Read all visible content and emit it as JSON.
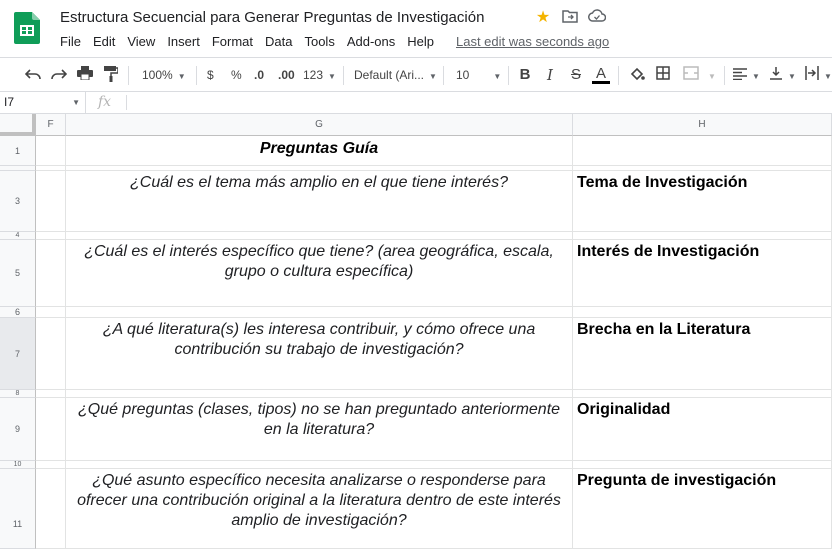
{
  "doc": {
    "title": "Estructura Secuencial para Generar Preguntas de Investigación",
    "last_edit": "Last edit was seconds ago"
  },
  "menu": [
    "File",
    "Edit",
    "View",
    "Insert",
    "Format",
    "Data",
    "Tools",
    "Add-ons",
    "Help"
  ],
  "toolbar": {
    "zoom": "100%",
    "currency": "$",
    "percent": "%",
    "dec_less": ".0",
    "dec_more": ".00",
    "num_format": "123",
    "font": "Default (Ari...",
    "font_size": "10",
    "bold": "B",
    "italic": "I",
    "strike": "S",
    "text_color": "A"
  },
  "formula_bar": {
    "cell_ref": "I7",
    "fx": "fx",
    "value": ""
  },
  "columns": {
    "F": "F",
    "G": "G",
    "H": "H"
  },
  "rows": {
    "r1": "1",
    "r3": "3",
    "r4": "4",
    "r5": "5",
    "r6": "6",
    "r7": "7",
    "r8": "8",
    "r9": "9",
    "r10": "10",
    "r11": "11"
  },
  "sheet": {
    "g1": "Preguntas Guía",
    "g3": "¿Cuál es el tema más amplio en el que tiene interés?",
    "h3": "Tema de Investigación",
    "g5": "¿Cuál es el interés específico que tiene? (area geográfica, escala, grupo o cultura específica)",
    "h5": "Interés de Investigación",
    "g7": "¿A qué literatura(s) les interesa contribuir, y cómo ofrece una contribución su trabajo de investigación?",
    "h7": "Brecha en la Literatura",
    "g9": "¿Qué preguntas (clases, tipos) no se han preguntado anteriormente en la literatura?",
    "h9": "Originalidad",
    "g11": "¿Qué asunto específico necesita analizarse o responderse para ofrecer una contribución original a la literatura dentro de este interés amplio de investigación?",
    "h11": "Pregunta de investigación"
  },
  "colors": {
    "sheets_green": "#0f9d58",
    "star": "#f4b400",
    "grid_line": "#e2e3e3"
  }
}
